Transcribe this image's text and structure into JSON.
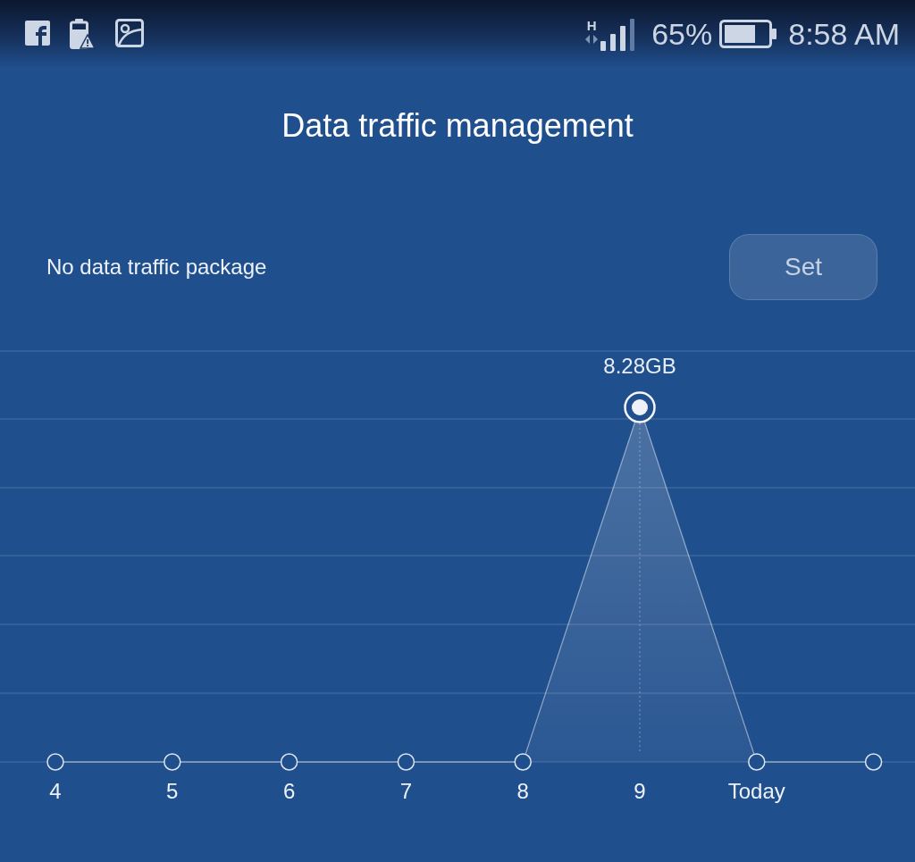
{
  "status_bar": {
    "network_type": "H",
    "battery": "65%",
    "time": "8:58 AM"
  },
  "title": "Data traffic management",
  "package": {
    "text": "No data traffic package",
    "button": "Set"
  },
  "usage_chart": {
    "points": [
      {
        "label": "4",
        "selected": false
      },
      {
        "label": "5",
        "selected": false
      },
      {
        "label": "6",
        "selected": false
      },
      {
        "label": "7",
        "selected": false
      },
      {
        "label": "8",
        "selected": false
      },
      {
        "label": "9",
        "selected": true,
        "value_label": "8.28GB"
      },
      {
        "label": "Today",
        "selected": false
      },
      {
        "selected": false
      }
    ]
  }
}
